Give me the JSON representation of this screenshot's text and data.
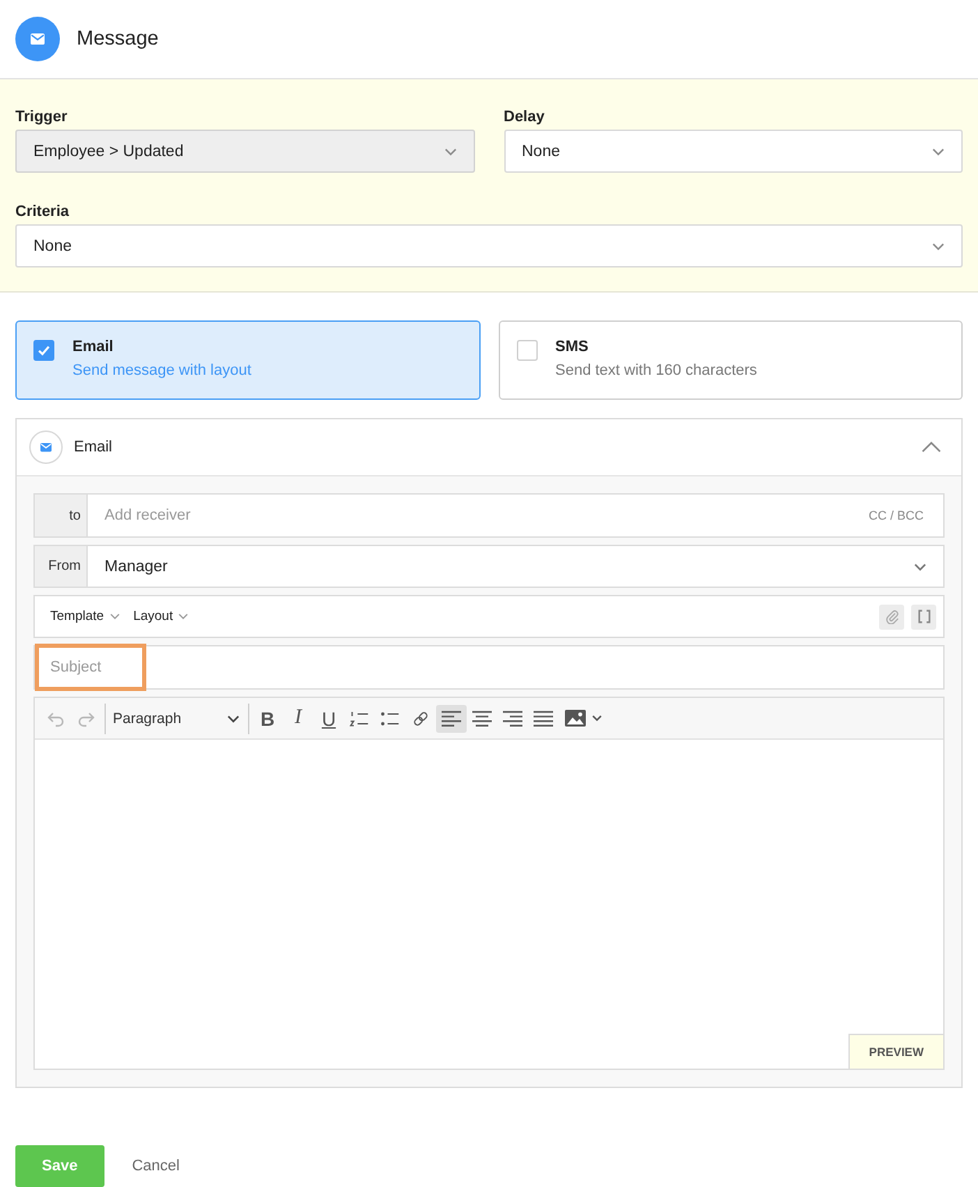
{
  "header": {
    "title": "Message"
  },
  "settings": {
    "rows": [
      {
        "fields": [
          {
            "label": "Trigger",
            "value": "Employee > Updated",
            "disabled": true
          },
          {
            "label": "Delay",
            "value": "None",
            "disabled": false
          }
        ]
      },
      {
        "fields": [
          {
            "label": "Criteria",
            "value": "None",
            "disabled": false
          }
        ]
      }
    ]
  },
  "channels": [
    {
      "title": "Email",
      "description": "Send message with layout",
      "selected": true
    },
    {
      "title": "SMS",
      "description": "Send text with 160 characters",
      "selected": false
    }
  ],
  "email_panel": {
    "title": "Email",
    "expanded": true,
    "to": {
      "label": "to",
      "placeholder": "Add receiver",
      "link": "CC / BCC"
    },
    "from": {
      "label": "From",
      "value": "Manager"
    },
    "menus": [
      "Template",
      "Layout"
    ],
    "subject": {
      "placeholder": "Subject",
      "highlighted": true
    },
    "editor": {
      "history": [
        {
          "kind": "undo",
          "disabled": true
        },
        {
          "kind": "redo",
          "disabled": true
        }
      ],
      "block_format": "Paragraph",
      "formatting": [
        {
          "kind": "bold",
          "label": "B"
        },
        {
          "kind": "italic",
          "label": "I"
        },
        {
          "kind": "underline",
          "label": "U"
        },
        {
          "kind": "numbered-list"
        },
        {
          "kind": "bulleted-list"
        },
        {
          "kind": "link"
        }
      ],
      "alignment": [
        {
          "kind": "left",
          "selected": true
        },
        {
          "kind": "center",
          "selected": false
        },
        {
          "kind": "right",
          "selected": false
        },
        {
          "kind": "justify",
          "selected": false
        }
      ],
      "insert": [
        {
          "kind": "image"
        }
      ],
      "preview": "PREVIEW"
    }
  },
  "actions": [
    {
      "label": "Save",
      "kind": "primary"
    },
    {
      "label": "Cancel",
      "kind": "secondary"
    }
  ]
}
